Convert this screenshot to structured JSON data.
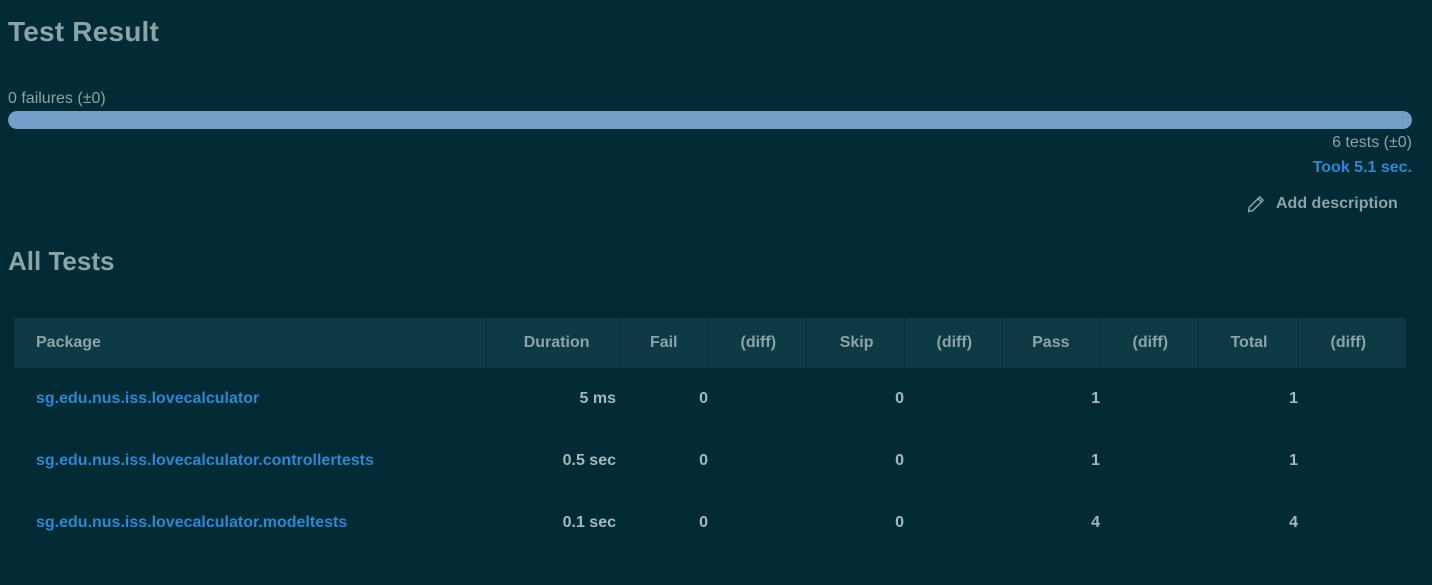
{
  "header": {
    "title": "Test Result"
  },
  "summary": {
    "failures_text": "0 failures (±0)",
    "progress_pass_fraction": 1.0,
    "tests_text": "6 tests (±0)",
    "took_text": "Took 5.1 sec.",
    "add_description_label": "Add description"
  },
  "all_tests": {
    "heading": "All Tests",
    "columns": {
      "package": "Package",
      "duration": "Duration",
      "fail": "Fail",
      "fail_diff": "(diff)",
      "skip": "Skip",
      "skip_diff": "(diff)",
      "pass": "Pass",
      "pass_diff": "(diff)",
      "total": "Total",
      "total_diff": "(diff)"
    },
    "rows": [
      {
        "package": "sg.edu.nus.iss.lovecalculator",
        "duration": "5 ms",
        "fail": "0",
        "fail_diff": "",
        "skip": "0",
        "skip_diff": "",
        "pass": "1",
        "pass_diff": "",
        "total": "1",
        "total_diff": ""
      },
      {
        "package": "sg.edu.nus.iss.lovecalculator.controllertests",
        "duration": "0.5 sec",
        "fail": "0",
        "fail_diff": "",
        "skip": "0",
        "skip_diff": "",
        "pass": "1",
        "pass_diff": "",
        "total": "1",
        "total_diff": ""
      },
      {
        "package": "sg.edu.nus.iss.lovecalculator.modeltests",
        "duration": "0.1 sec",
        "fail": "0",
        "fail_diff": "",
        "skip": "0",
        "skip_diff": "",
        "pass": "4",
        "pass_diff": "",
        "total": "4",
        "total_diff": ""
      }
    ]
  },
  "colors": {
    "background": "#022b36",
    "progress_pass": "#739fc9",
    "link": "#2f86d1",
    "header_row": "#0d3a44"
  },
  "icons": {
    "add_description": "pencil-icon"
  }
}
